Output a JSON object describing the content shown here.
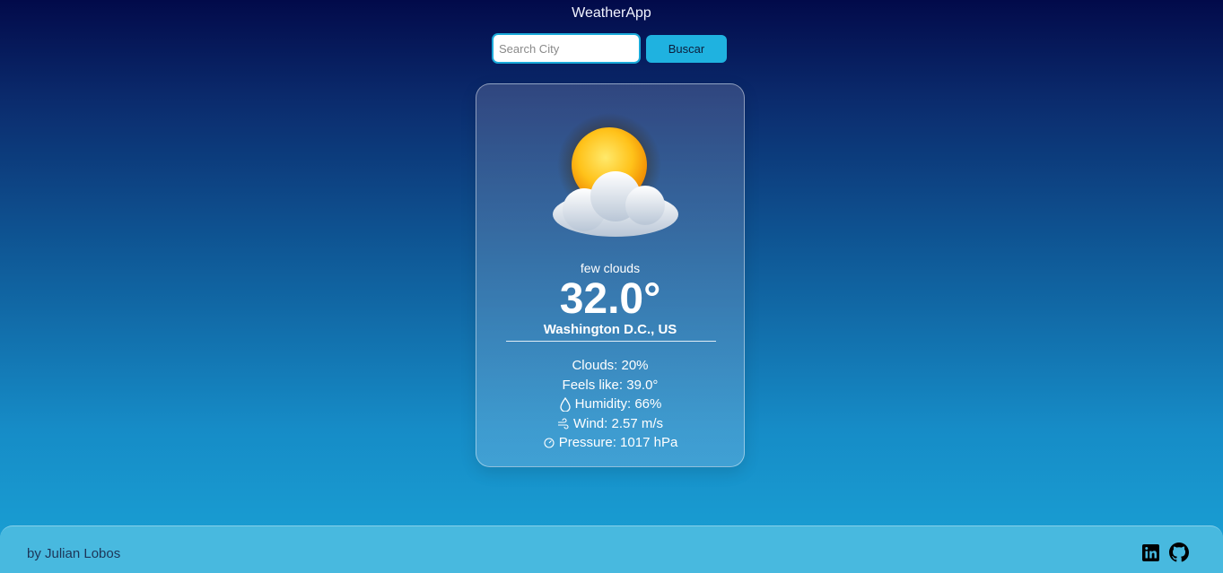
{
  "app": {
    "title": "WeatherApp"
  },
  "search": {
    "placeholder": "Search City",
    "value": "",
    "button_label": "Buscar"
  },
  "weather": {
    "condition_icon": "sun-behind-cloud-icon",
    "description": "few clouds",
    "temperature": "32.0°",
    "location": "Washington D.C., US",
    "details": {
      "clouds": "Clouds: 20%",
      "feels_like": "Feels like: 39.0°",
      "humidity": "Humidity: 66%",
      "wind": "Wind: 2.57 m/s",
      "pressure": "Pressure: 1017 hPa"
    }
  },
  "footer": {
    "credit": "by Julian Lobos",
    "links": [
      {
        "icon": "linkedin-icon"
      },
      {
        "icon": "github-icon"
      }
    ]
  },
  "colors": {
    "gradient_top": "#020a4a",
    "gradient_bottom": "#1aa3d6",
    "accent": "#1fb2e0",
    "footer_bg": "#48b9df"
  }
}
